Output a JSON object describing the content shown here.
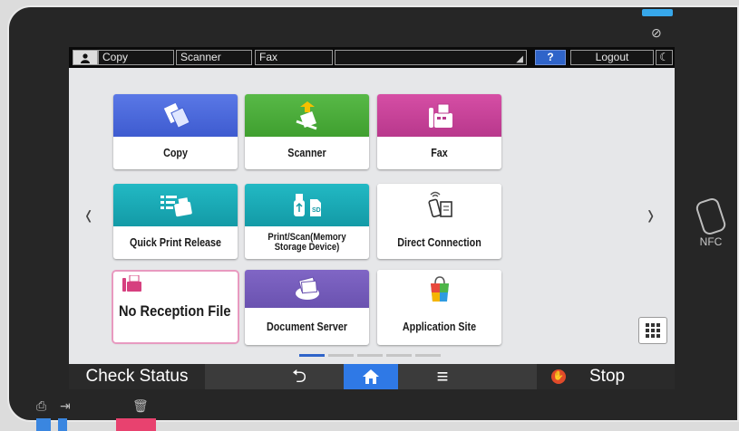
{
  "topbar": {
    "user_icon": "user-icon",
    "tabs": [
      "Copy",
      "Scanner",
      "Fax"
    ],
    "help": "?",
    "logout": "Logout",
    "sleep_icon": "moon-icon"
  },
  "tiles": [
    {
      "label": "Copy",
      "icon": "copy-icon",
      "color": "#4a67db"
    },
    {
      "label": "Scanner",
      "icon": "scanner-icon",
      "color": "#4aae3a"
    },
    {
      "label": "Fax",
      "icon": "fax-icon",
      "color": "#c8439a"
    },
    {
      "label": "Quick Print Release",
      "icon": "printer-icon",
      "color": "#1aaab6"
    },
    {
      "label": "Print/Scan(Memory Storage Device)",
      "icon": "usb-sd-icon",
      "color": "#1aaab6"
    },
    {
      "label": "Direct Connection",
      "icon": "phone-printer-icon",
      "color": "#ffffff"
    },
    {
      "label": "No Reception File",
      "icon": "fax-small-icon",
      "color": "#ffffff"
    },
    {
      "label": "Document Server",
      "icon": "document-stack-icon",
      "color": "#755bba"
    },
    {
      "label": "Application Site",
      "icon": "app-bag-icon",
      "color": "#ffffff"
    }
  ],
  "pager": {
    "pages": 5,
    "current": 1
  },
  "bottombar": {
    "check_status": "Check Status",
    "back_icon": "back-arrow-icon",
    "home_icon": "home-icon",
    "menu_icon": "menu-icon",
    "stop": "Stop"
  },
  "hardware": {
    "nfc": "NFC"
  }
}
